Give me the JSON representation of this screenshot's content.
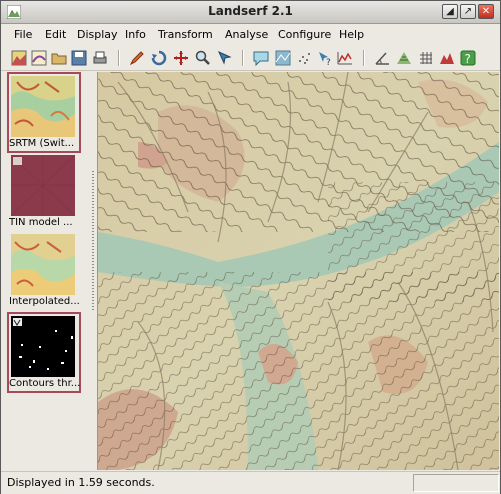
{
  "window": {
    "title": "Landserf 2.1"
  },
  "menu": [
    "File",
    "Edit",
    "Display",
    "Info",
    "Transform",
    "Analyse",
    "Configure",
    "Help"
  ],
  "toolbar": {
    "icons": [
      "new-raster-icon",
      "new-vector-icon",
      "open-icon",
      "save-icon",
      "print-icon",
      "edit-pencil-icon",
      "rotate-icon",
      "pan-icon",
      "zoom-icon",
      "select-icon",
      "info-balloon-icon",
      "relief-icon",
      "scatter-icon",
      "query-icon",
      "profile-icon",
      "angle-icon",
      "contour-icon",
      "grid-icon",
      "peak-icon",
      "help-icon"
    ]
  },
  "thumbnails": [
    {
      "label": "SRTM (Swit...",
      "kind": "relief",
      "selected": true
    },
    {
      "label": "TIN model ...",
      "kind": "tin",
      "selected": false
    },
    {
      "label": "Interpolated...",
      "kind": "relief",
      "selected": false
    },
    {
      "label": "Contours thr...",
      "kind": "contours",
      "selected": true
    }
  ],
  "status": {
    "message": "Displayed  in 1.59 seconds."
  },
  "colors": {
    "selection": "#a44a58",
    "lowland": "#9cc4b2",
    "midland": "#d9cfa3",
    "highland": "#c89a86"
  }
}
